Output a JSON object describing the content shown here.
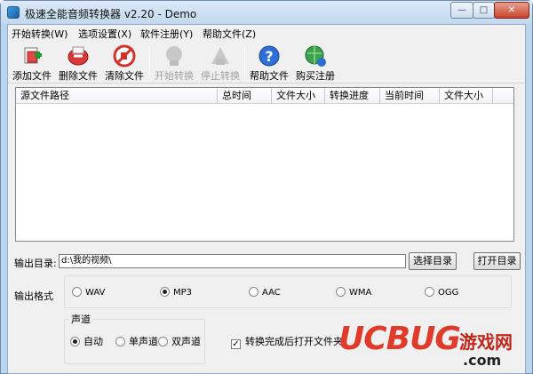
{
  "window": {
    "title": "极速全能音频转换器 v2.20 - Demo",
    "minimize": "—",
    "maximize": "□",
    "close": "✕"
  },
  "menu": [
    "开始转换(W)",
    "选项设置(X)",
    "软件注册(Y)",
    "帮助文件(Z)"
  ],
  "toolbar": {
    "add": "添加文件",
    "delete": "删除文件",
    "clear": "清除文件",
    "start": "开始转换",
    "stop": "停止转换",
    "help": "帮助文件",
    "buy": "购买注册"
  },
  "list": {
    "columns": [
      "源文件路径",
      "总时间",
      "文件大小",
      "转换进度",
      "当前时间",
      "文件大小"
    ]
  },
  "output": {
    "dir_label": "输出目录:",
    "dir_value": "d:\\我的视频\\",
    "select_dir": "选择目录",
    "open_dir": "打开目录",
    "format_label": "输出格式",
    "formats": [
      "WAV",
      "MP3",
      "AAC",
      "WMA",
      "OGG"
    ],
    "selected_format": "MP3"
  },
  "channel": {
    "label": "声道",
    "options": [
      "自动",
      "单声道",
      "双声道"
    ],
    "selected": "自动"
  },
  "open_folder_after": {
    "label": "转换完成后打开文件夹",
    "checked": true,
    "mark": "✓"
  },
  "watermark": {
    "brand": "UCBUG",
    "cn": "游戏网",
    "domain": ".com"
  }
}
